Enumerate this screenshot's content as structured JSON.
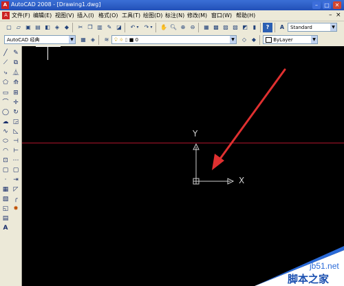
{
  "title_bar": {
    "app_icon": "A",
    "title": "AutoCAD 2008 - [Drawing1.dwg]"
  },
  "menubar": {
    "items": [
      "文件(F)",
      "编辑(E)",
      "视图(V)",
      "插入(I)",
      "格式(O)",
      "工具(T)",
      "绘图(D)",
      "标注(N)",
      "修改(M)",
      "窗口(W)",
      "帮助(H)"
    ]
  },
  "toolbar2": {
    "workspace": "AutoCAD 经典",
    "layer_value": "0",
    "color_value": "ByLayer",
    "text_style": "Standard"
  },
  "canvas": {
    "ucs_y_label": "Y",
    "ucs_x_label": "X",
    "horizontal_line_color": "#b0142c",
    "arrow_color": "#e03030"
  },
  "watermark": {
    "site": "jb51.net",
    "name": "脚本之家"
  }
}
